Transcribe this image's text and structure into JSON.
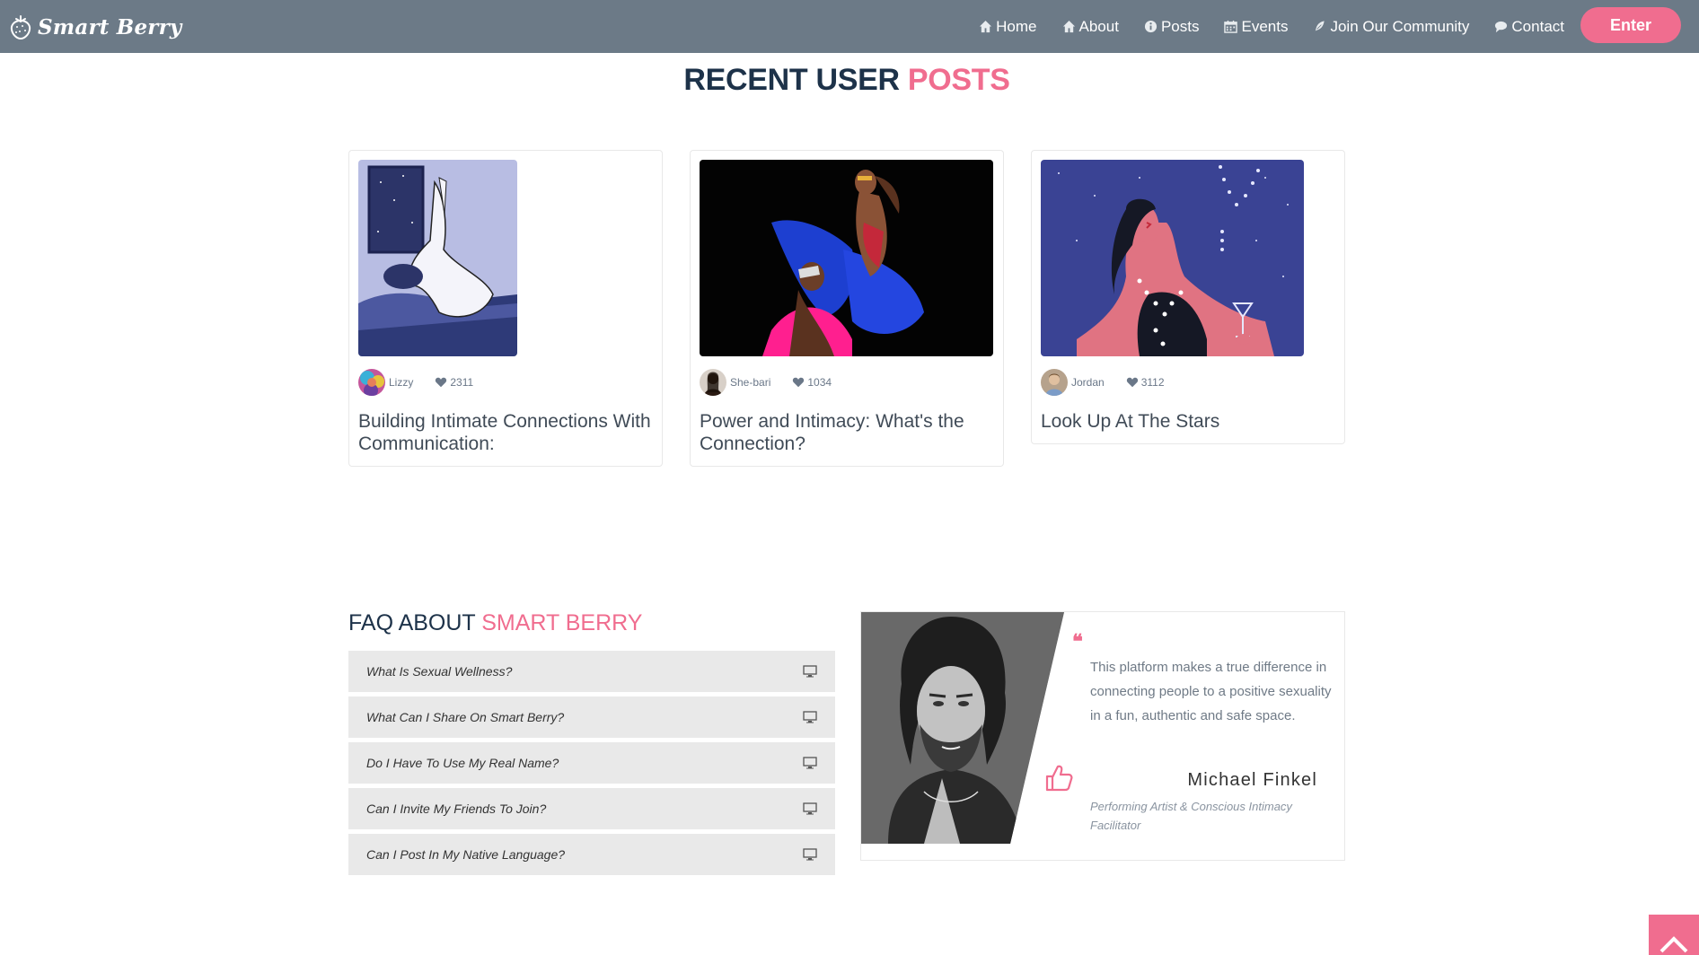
{
  "brand": {
    "name": "Smart Berry",
    "logo_icon": "strawberry-icon"
  },
  "nav": {
    "items": [
      {
        "label": "Home",
        "icon": "home-icon"
      },
      {
        "label": "About",
        "icon": "home-icon"
      },
      {
        "label": "Posts",
        "icon": "info-icon"
      },
      {
        "label": "Events",
        "icon": "calendar-icon"
      },
      {
        "label": "Join Our Community",
        "icon": "feather-icon"
      },
      {
        "label": "Contact",
        "icon": "chat-icon"
      }
    ],
    "enter_label": "Enter"
  },
  "posts_section": {
    "title_main": "RECENT USER",
    "title_accent": "POSTS",
    "posts": [
      {
        "author": "Lizzy",
        "likes": "2311",
        "title": "Building Intimate Connections With Communication:"
      },
      {
        "author": "She-bari",
        "likes": "1034",
        "title": "Power and Intimacy: What's the Connection?"
      },
      {
        "author": "Jordan",
        "likes": "3112",
        "title": "Look Up At The Stars"
      }
    ]
  },
  "faq": {
    "title_main": "FAQ ABOUT",
    "title_accent": "SMART BERRY",
    "items": [
      "What Is Sexual Wellness?",
      "What Can I Share On Smart Berry?",
      "Do I Have To Use My Real Name?",
      "Can I Invite My Friends To Join?",
      "Can I Post In My Native Language?"
    ]
  },
  "testimonial": {
    "quote_mark": "❝",
    "text": "This platform makes a true difference in connecting people to a positive sexuality in a fun, authentic and safe space.",
    "name": "Michael Finkel",
    "role": "Performing Artist & Conscious Intimacy Facilitator"
  },
  "colors": {
    "navbar": "#6c7a87",
    "accent": "#f06d8f",
    "heading": "#1d3249",
    "faq_bg": "#e9e9e9"
  }
}
